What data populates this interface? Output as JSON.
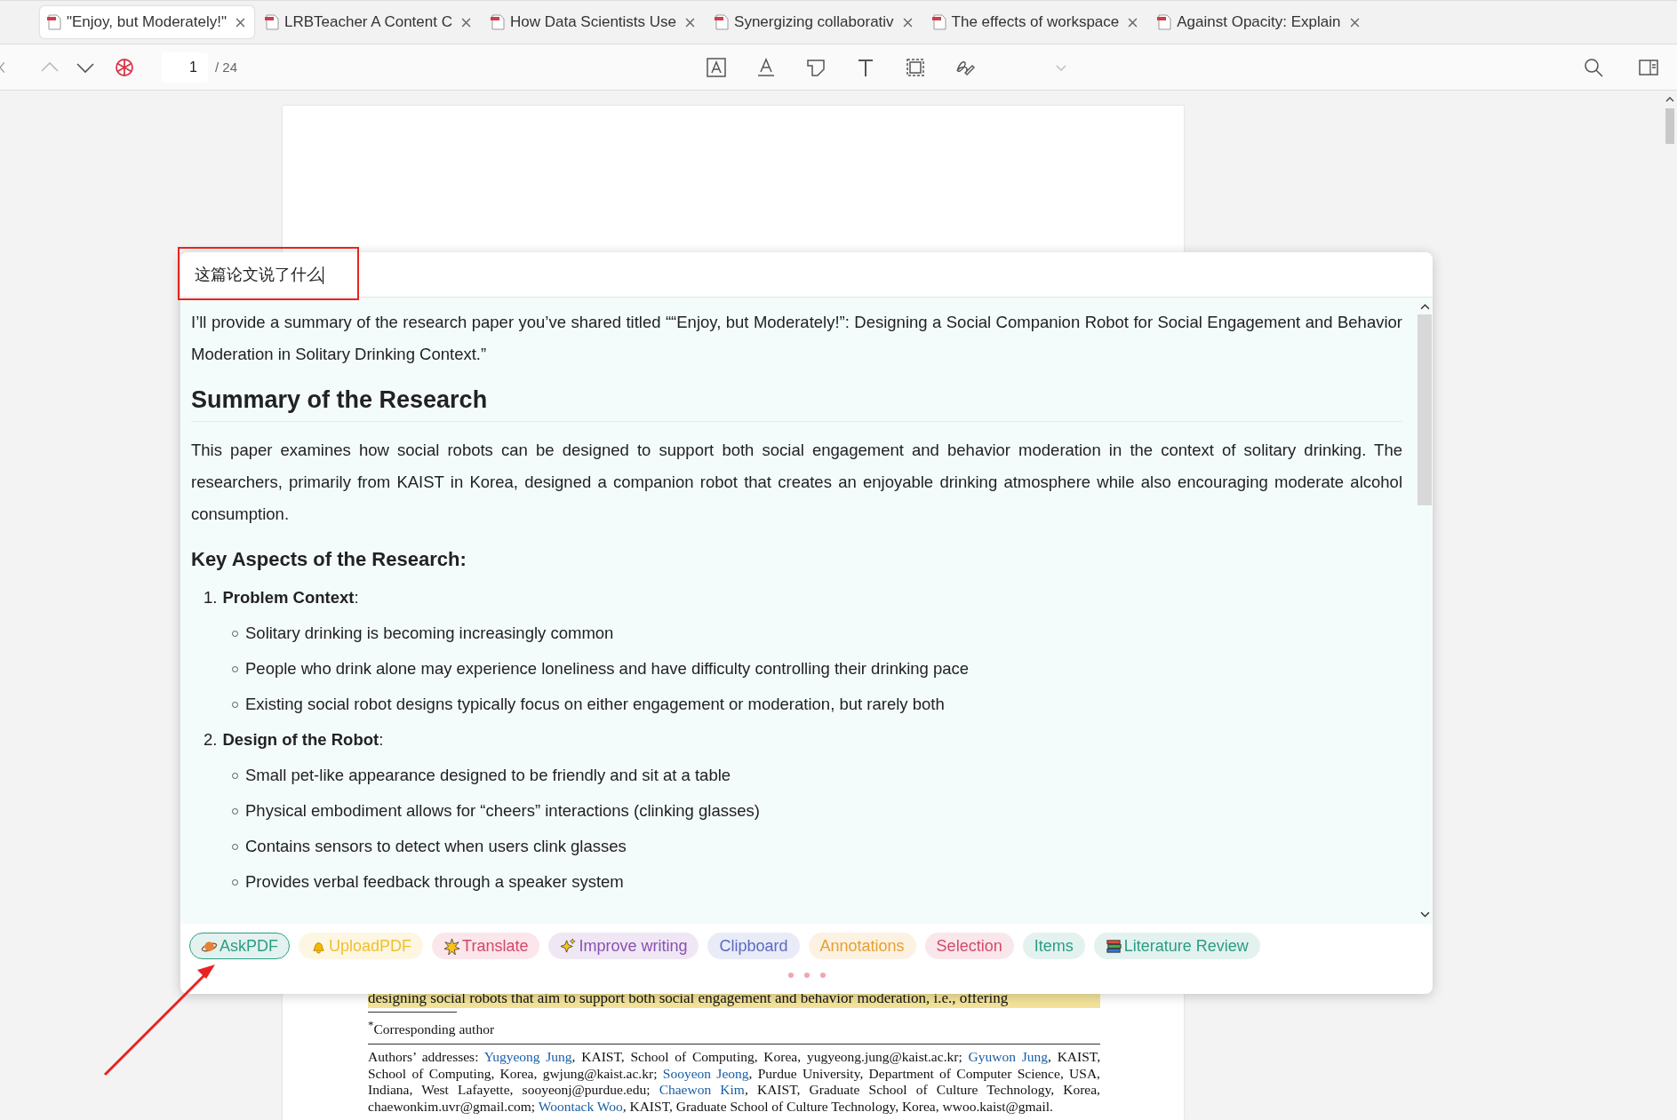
{
  "tabs": [
    {
      "label": "\"Enjoy, but Moderately!\"",
      "selected": true
    },
    {
      "label": "LRBTeacher A Content C",
      "selected": false
    },
    {
      "label": "How Data Scientists Use",
      "selected": false
    },
    {
      "label": "Synergizing collaborativ",
      "selected": false
    },
    {
      "label": "The effects of workspace",
      "selected": false
    },
    {
      "label": "Against Opacity: Explain",
      "selected": false
    }
  ],
  "toolbar": {
    "page": "1",
    "total": "/ 24"
  },
  "pdf": {
    "highlight_line": {
      "text": "designing social robots that aim to support both social engagement and behavior moderation, i.e., offering",
      "highlighted": true
    },
    "footnote": "$^{*}$Corresponding author",
    "addresses": [
      {
        "text": "Authors’ addresses: ",
        "link": false
      },
      {
        "text": "Yugyeong Jung",
        "link": true
      },
      {
        "text": ", KAIST, School of Computing, Korea, yugyeong.jung@kaist.ac.kr; ",
        "link": false
      },
      {
        "text": "Gyuwon Jung",
        "link": true
      },
      {
        "text": ", KAIST, School of Computing, Korea, gwjung@kaist.ac.kr; ",
        "link": false
      },
      {
        "text": "Sooyeon Jeong",
        "link": true
      },
      {
        "text": ", Purdue University, Department of Computer Science, USA, Indiana, West Lafayette, sooyeonj@purdue.edu; ",
        "link": false
      },
      {
        "text": "Chaewon Kim",
        "link": true
      },
      {
        "text": ", KAIST, Graduate School of Culture Technology, Korea, chaewonkim.uvr@gmail.com; ",
        "link": false
      },
      {
        "text": "Woontack Woo",
        "link": true
      },
      {
        "text": ", KAIST, Graduate School of Culture Technology, Korea, wwoo.kaist@gmail.",
        "link": false
      }
    ]
  },
  "popup": {
    "query": "这篇论文说了什么",
    "intro": "I’ll provide a summary of the research paper you’ve shared titled ““Enjoy, but Moderately!”: Designing a Social Companion Robot for Social Engagement and Behavior Moderation in Solitary Drinking Context.”",
    "heading": "Summary of the Research",
    "paragraph": "This paper examines how social robots can be designed to support both social engagement and behavior moderation in the context of solitary drinking. The researchers, primarily from KAIST in Korea, designed a companion robot that creates an enjoyable drinking atmosphere while also encouraging moderate alcohol consumption.",
    "subheading": "Key Aspects of the Research:",
    "list": [
      {
        "number": "1.",
        "title": "**Problem Context**:",
        "bullets": [
          "Solitary drinking is becoming increasingly common",
          "People who drink alone may experience loneliness and have difficulty controlling their drinking pace",
          "Existing social robot designs typically focus on either engagement or moderation, but rarely both"
        ]
      },
      {
        "number": "2.",
        "title": "**Design of the Robot**:",
        "bullets": [
          "Small pet-like appearance designed to be friendly and sit at a table",
          "Physical embodiment allows for “cheers” interactions (clinking glasses)",
          "Contains sensors to detect when users clink glasses",
          "Provides verbal feedback through a speaker system"
        ]
      }
    ],
    "chips": [
      {
        "label": "AskPDF",
        "color": "#2a9d85",
        "selected": true
      },
      {
        "label": "UploadPDF",
        "color": "#f0bf2e",
        "selected": false
      },
      {
        "label": "Translate",
        "color": "#d6466a",
        "selected": false
      },
      {
        "label": "Improve writing",
        "color": "#8a4fb0",
        "selected": false
      },
      {
        "label": "Clipboard",
        "color": "#5a6bc0",
        "selected": false
      },
      {
        "label": "Annotations",
        "color": "#e6a030",
        "selected": false
      },
      {
        "label": "Selection",
        "color": "#d44a6a",
        "selected": false
      },
      {
        "label": "Items",
        "color": "#2a9d85",
        "selected": false
      },
      {
        "label": "Literature Review",
        "color": "#2a9d85",
        "selected": false
      }
    ]
  }
}
